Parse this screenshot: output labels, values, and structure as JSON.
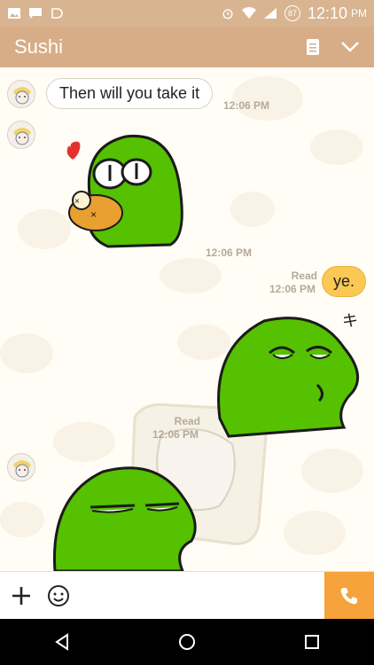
{
  "status_bar": {
    "time": "12:10",
    "ampm": "PM",
    "battery": "87"
  },
  "header": {
    "title": "Sushi"
  },
  "messages": {
    "m1_text": "Then will you take it",
    "m1_time": "12:06 PM",
    "m2_time": "12:06 PM",
    "m3_read": "Read",
    "m3_time": "12:06 PM",
    "m3_text": "ye.",
    "m4_read": "Read",
    "m4_time": "12:06 PM"
  },
  "colors": {
    "header": "#d6ad87",
    "status": "#d8b491",
    "bubble_right": "#fbc854",
    "call": "#f5a33a"
  }
}
